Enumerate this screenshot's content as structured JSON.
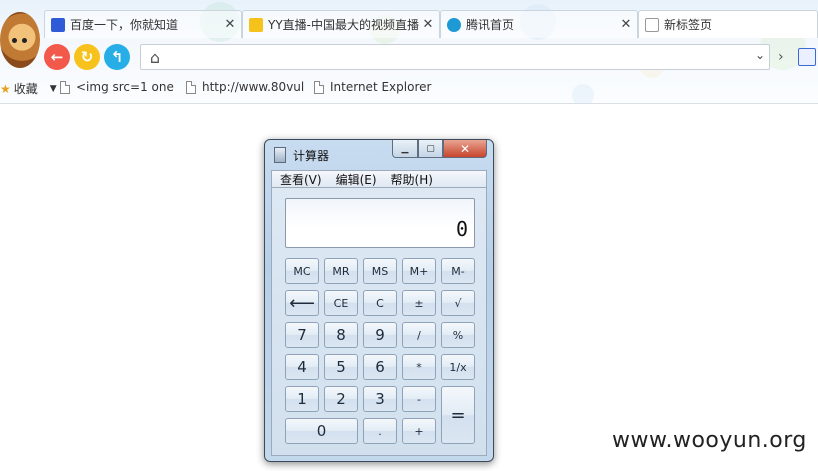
{
  "browser": {
    "tabs": [
      {
        "title": "百度一下，你就知道",
        "icon": "baidu-paw-icon",
        "icon_color": "#2f5bd6"
      },
      {
        "title": "YY直播-中国最大的视频直播",
        "icon": "yy-icon",
        "icon_color": "#f4c21a"
      },
      {
        "title": "腾讯首页",
        "icon": "qq-icon",
        "icon_color": "#1d9ad6"
      },
      {
        "title": "新标签页",
        "icon": "blank-page-icon",
        "icon_color": "#ffffff"
      }
    ],
    "tab_close_glyph": "✕",
    "nav": {
      "back_color": "#f2594b",
      "refresh_color": "#f7c21c",
      "undo_color": "#27aee6"
    },
    "address": {
      "value": "",
      "dropdown_glyph": "⌄"
    },
    "favorites": {
      "label": "收藏",
      "items": [
        "<img src=1 one",
        "http://www.80vul",
        "Internet Explorer"
      ]
    }
  },
  "calculator": {
    "title": "计算器",
    "menus": [
      "查看(V)",
      "编辑(E)",
      "帮助(H)"
    ],
    "display": "0",
    "rows": [
      [
        "MC",
        "MR",
        "MS",
        "M+",
        "M-"
      ],
      [
        "⟵",
        "CE",
        "C",
        "±",
        "√"
      ],
      [
        "7",
        "8",
        "9",
        "/",
        "%"
      ],
      [
        "4",
        "5",
        "6",
        "*",
        "1/x"
      ],
      [
        "1",
        "2",
        "3",
        "-",
        "="
      ],
      [
        "0",
        ".",
        "+"
      ]
    ]
  },
  "watermark": "www.wooyun.org"
}
